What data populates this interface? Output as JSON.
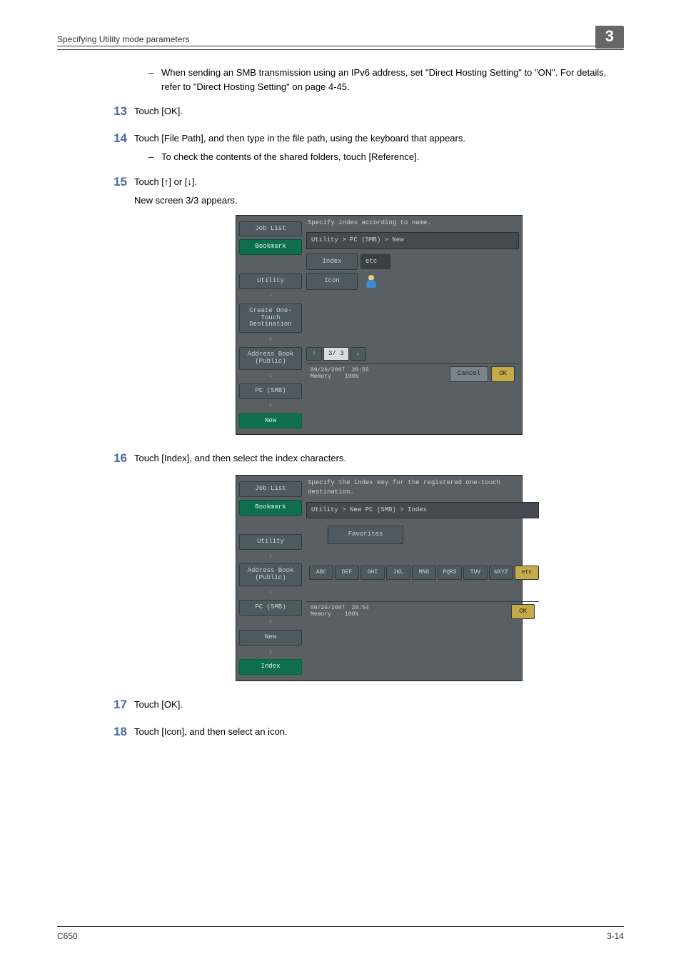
{
  "header": {
    "title": "Specifying Utility mode parameters",
    "chapter": "3"
  },
  "intro_bullet": "When sending an SMB transmission using an IPv6 address, set \"Direct Hosting Setting\" to \"ON\". For details, refer to \"Direct Hosting Setting\" on page 4-45.",
  "steps": {
    "s13": {
      "num": "13",
      "text": "Touch [OK]."
    },
    "s14": {
      "num": "14",
      "text": "Touch [File Path], and then type in the file path, using the keyboard that appears.",
      "sub": "To check the contents of the shared folders, touch [Reference]."
    },
    "s15": {
      "num": "15",
      "text": "Touch [↑] or [↓].",
      "after": "New screen 3/3 appears."
    },
    "s16": {
      "num": "16",
      "text": "Touch [Index], and then select the index characters."
    },
    "s17": {
      "num": "17",
      "text": "Touch [OK]."
    },
    "s18": {
      "num": "18",
      "text": "Touch [Icon], and then select an icon."
    }
  },
  "panel1": {
    "msg": "Specify index according to name.",
    "breadcrumb": "Utility > PC (SMB) > New",
    "left": {
      "job_list": "Job List",
      "bookmark": "Bookmark",
      "utility": "Utility",
      "create": "Create One-Touch\nDestination",
      "addrbook": "Address Book\n(Public)",
      "pcsmb": "PC (SMB)",
      "new": "New"
    },
    "fields": {
      "index_label": "Index",
      "index_value": "etc",
      "icon_label": "Icon"
    },
    "nav": {
      "up": "↑",
      "page": "3/ 3",
      "down": "↓"
    },
    "foot": {
      "date": "09/26/2007",
      "time": "20:55",
      "mem_label": "Memory",
      "mem": "100%",
      "cancel": "Cancel",
      "ok": "OK"
    }
  },
  "panel2": {
    "msg": "Specify the index key for the registered one-touch destination.",
    "breadcrumb": "Utility > New PC (SMB) > Index",
    "left": {
      "job_list": "Job List",
      "bookmark": "Bookmark",
      "utility": "Utility",
      "addrbook": "Address Book\n(Public)",
      "pcsmb": "PC (SMB)",
      "new": "New",
      "index": "Index"
    },
    "favorites": "Favorites",
    "keys": [
      "ABC",
      "DEF",
      "GHI",
      "JKL",
      "MNO",
      "PQRS",
      "TUV",
      "WXYZ",
      "etc"
    ],
    "foot": {
      "date": "09/26/2007",
      "time": "20:54",
      "mem_label": "Memory",
      "mem": "100%",
      "ok": "OK"
    }
  },
  "footer": {
    "left": "C650",
    "right": "3-14"
  }
}
